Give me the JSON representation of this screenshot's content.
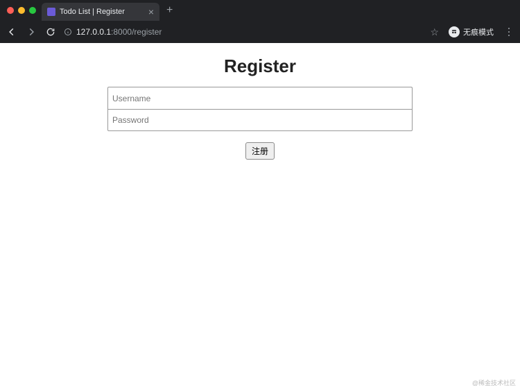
{
  "browser": {
    "tab_title": "Todo List | Register",
    "url_prefix": "127.0.0.1",
    "url_port_path": ":8000/register",
    "incognito_label": "无痕模式"
  },
  "page": {
    "heading": "Register",
    "username_placeholder": "Username",
    "password_placeholder": "Password",
    "submit_label": "注册"
  },
  "watermark": "@稀金技术社区"
}
